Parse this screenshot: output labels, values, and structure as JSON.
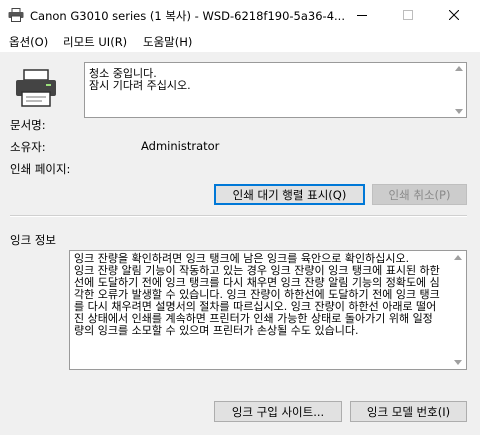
{
  "window": {
    "title": "Canon G3010 series (1 복사) - WSD-6218f190-5a36-4..."
  },
  "menu": {
    "items": [
      "옵션(O)",
      "리모트 UI(R)",
      "도움말(H)"
    ]
  },
  "status": {
    "lines": [
      "청소 중입니다.",
      "잠시 기다려 주십시오."
    ]
  },
  "info": {
    "document_label": "문서명:",
    "document_value": "",
    "owner_label": "소유자:",
    "owner_value": "Administrator",
    "pages_label": "인쇄 페이지:",
    "pages_value": ""
  },
  "buttons": {
    "print_queue": "인쇄 대기 행렬 표시(Q)",
    "cancel_print": "인쇄 취소(P)",
    "ink_purchase": "잉크 구입 사이트...",
    "ink_model": "잉크 모델 번호(I)"
  },
  "ink": {
    "section_label": "잉크 정보",
    "paragraphs": [
      "잉크 잔량을 확인하려면 잉크 탱크에 남은 잉크를 육안으로 확인하십시오.",
      "잉크 잔량 알림 기능이 작동하고 있는 경우 잉크 잔량이 잉크 탱크에 표시된 하한선에 도달하기 전에 잉크 탱크를 다시 채우면 잉크 잔량 알림 기능의 정확도에 심각한 오류가 발생할 수 있습니다. 잉크 잔량이 하한선에 도달하기 전에 잉크 탱크를 다시 채우려면 설명서의 절차를 따르십시오. 잉크 잔량이 하한선 아래로 떨어진 상태에서 인쇄를 계속하면 프린터가 인쇄 가능한 상태로 돌아가기 위해 일정량의 잉크를 소모할 수 있으며 프린터가 손상될 수도 있습니다."
    ]
  },
  "icons": {
    "app": "printer-app-icon",
    "printer": "printer-icon",
    "minimize": "minimize-icon",
    "maximize": "maximize-icon",
    "close": "close-icon"
  }
}
